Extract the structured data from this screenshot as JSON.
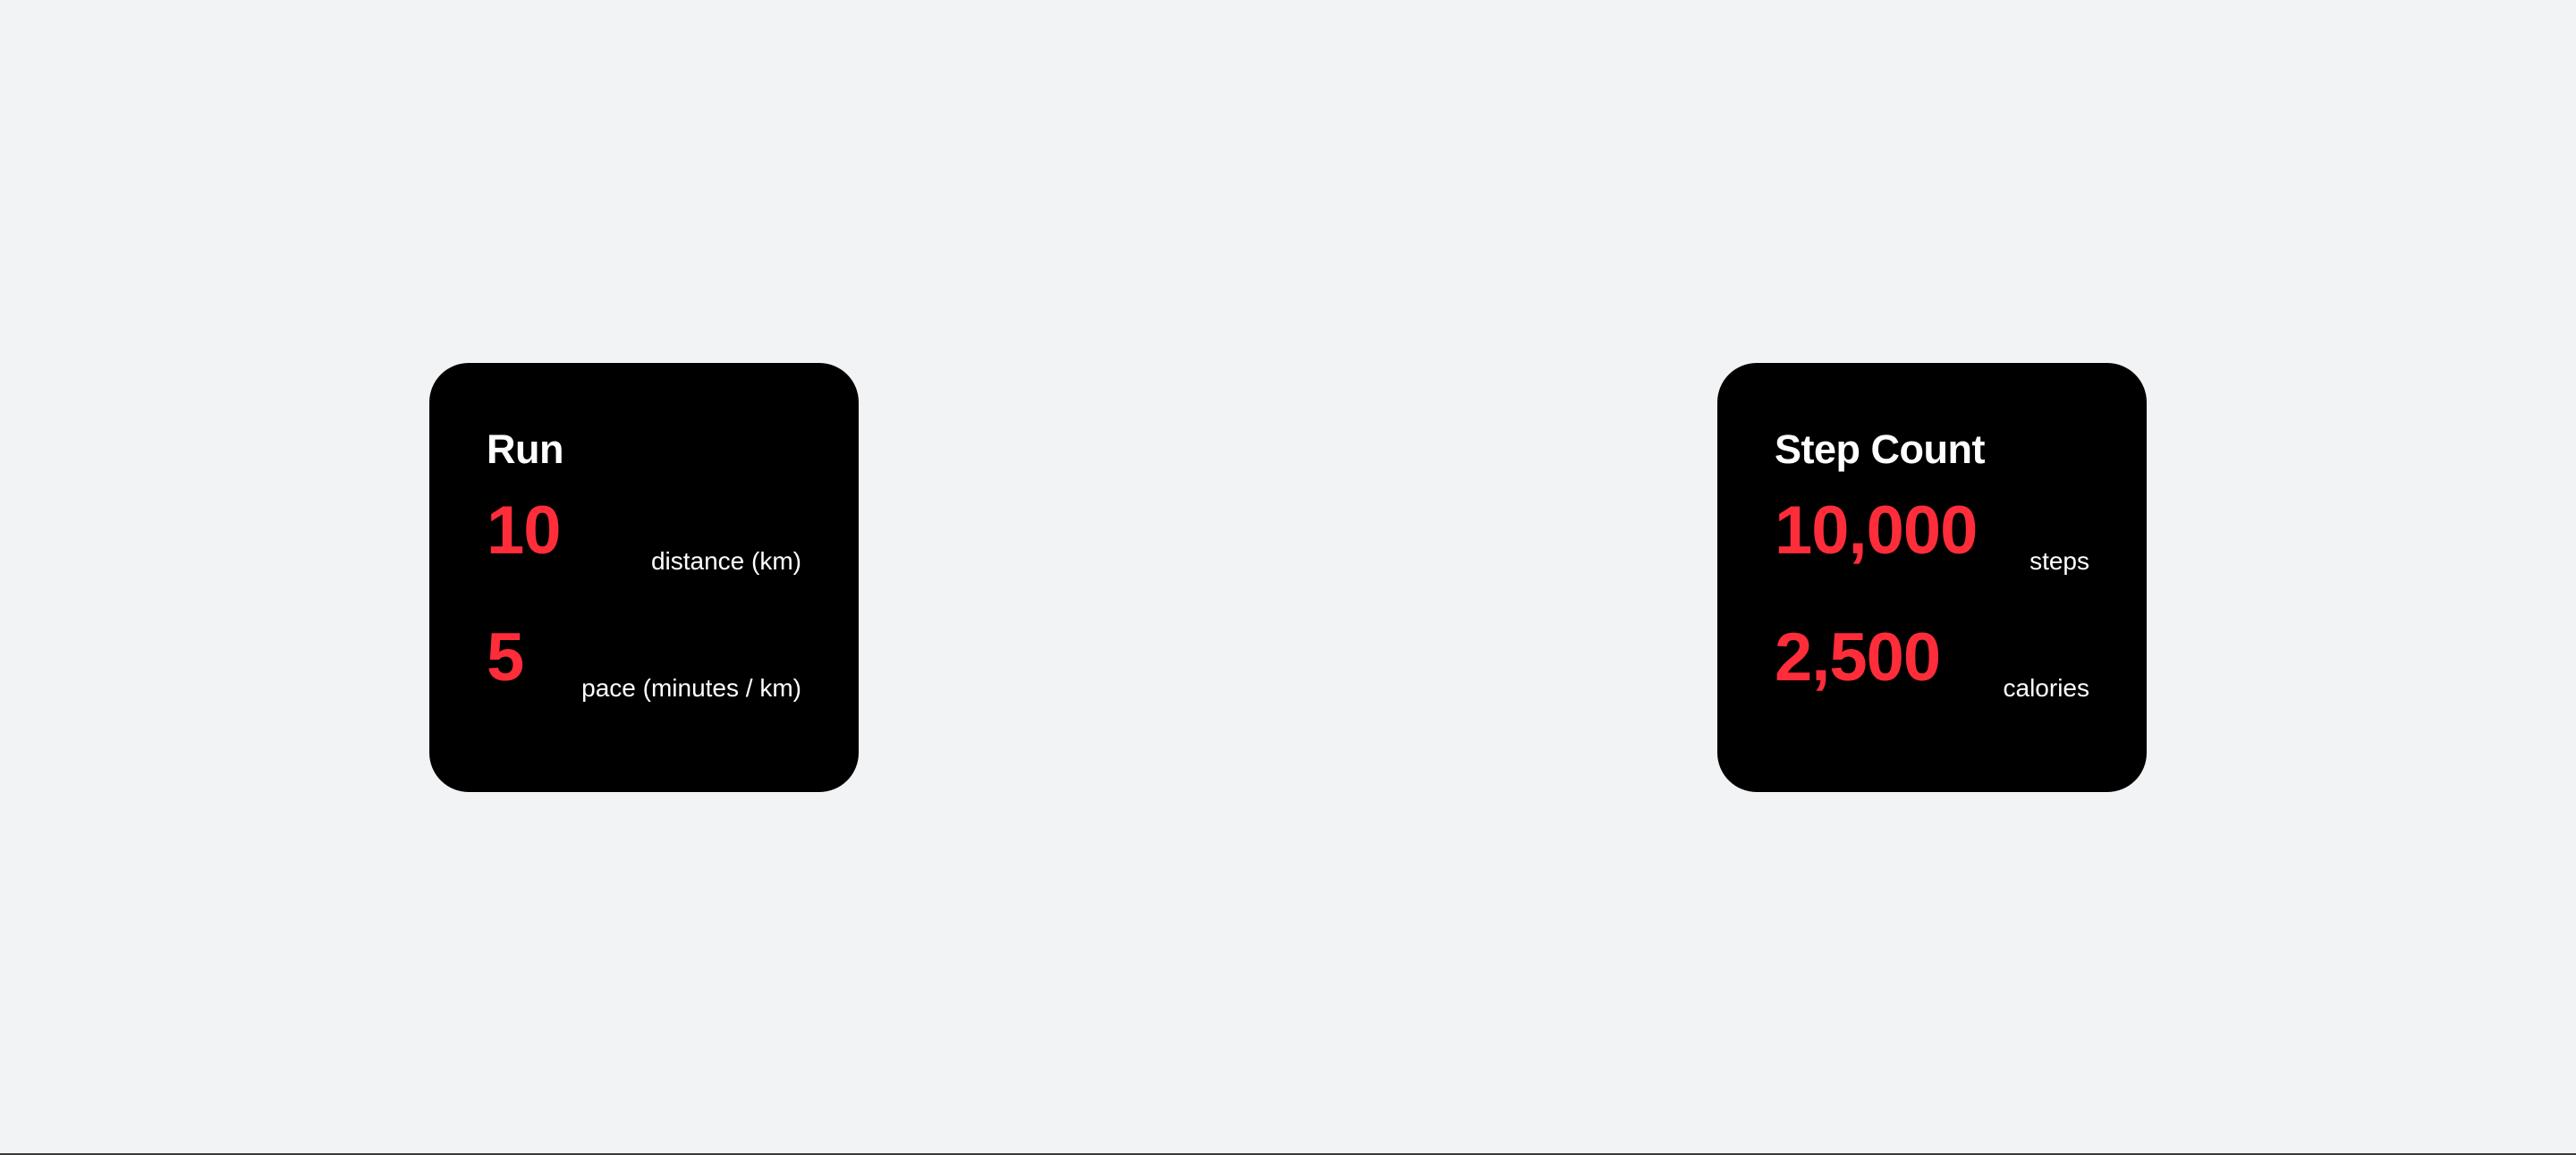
{
  "colors": {
    "background": "#f2f3f5",
    "card": "#000000",
    "accent": "#ff2d3a",
    "text": "#ffffff"
  },
  "cards": [
    {
      "title": "Run",
      "metrics": [
        {
          "value": "10",
          "label": "distance (km)"
        },
        {
          "value": "5",
          "label": "pace (minutes / km)"
        }
      ]
    },
    {
      "title": "Step Count",
      "metrics": [
        {
          "value": "10,000",
          "label": "steps"
        },
        {
          "value": "2,500",
          "label": "calories"
        }
      ]
    }
  ]
}
